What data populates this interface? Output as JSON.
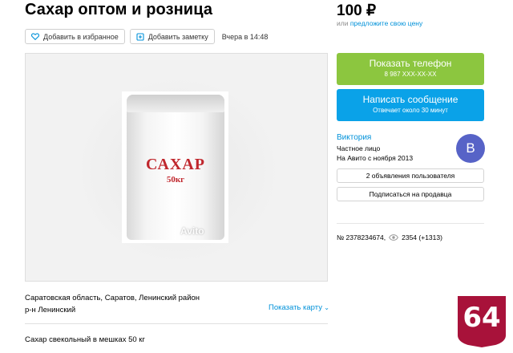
{
  "listing": {
    "title": "Сахар оптом и розница",
    "favorite_label": "Добавить в избранное",
    "note_label": "Добавить заметку",
    "updated": "Вчера в 14:48"
  },
  "gallery": {
    "sack_word": "САХАР",
    "sack_weight": "50кг",
    "watermark": "Avito"
  },
  "price": {
    "value": "100 ₽",
    "note_prefix": "или ",
    "note_link": "предложите свою цену"
  },
  "contact": {
    "phone_label": "Показать телефон",
    "phone_masked": "8 987 XXX-XX-XX",
    "message_label": "Написать сообщение",
    "message_sub": "Отвечает около 30 минут"
  },
  "seller": {
    "name": "Виктория",
    "type": "Частное лицо",
    "since": "На Авито с ноября 2013",
    "avatar_letter": "В",
    "avatar_color": "#5763c7",
    "ads_label": "2 объявления пользователя",
    "subscribe_label": "Подписаться на продавца"
  },
  "meta": {
    "ad_number": "№ 2378234674,",
    "views": "2354 (+1313)"
  },
  "location": {
    "line1": "Саратовская область, Саратов, Ленинский район",
    "line2": "р-н Ленинский",
    "map_link": "Показать карту"
  },
  "description": "Сахар свекольный в мешках 50 кг",
  "badge": {
    "text": "64",
    "color": "#a8123a"
  },
  "colors": {
    "accent_green": "#8cc63f",
    "accent_blue": "#0aa2e8",
    "link": "#0091d9"
  }
}
